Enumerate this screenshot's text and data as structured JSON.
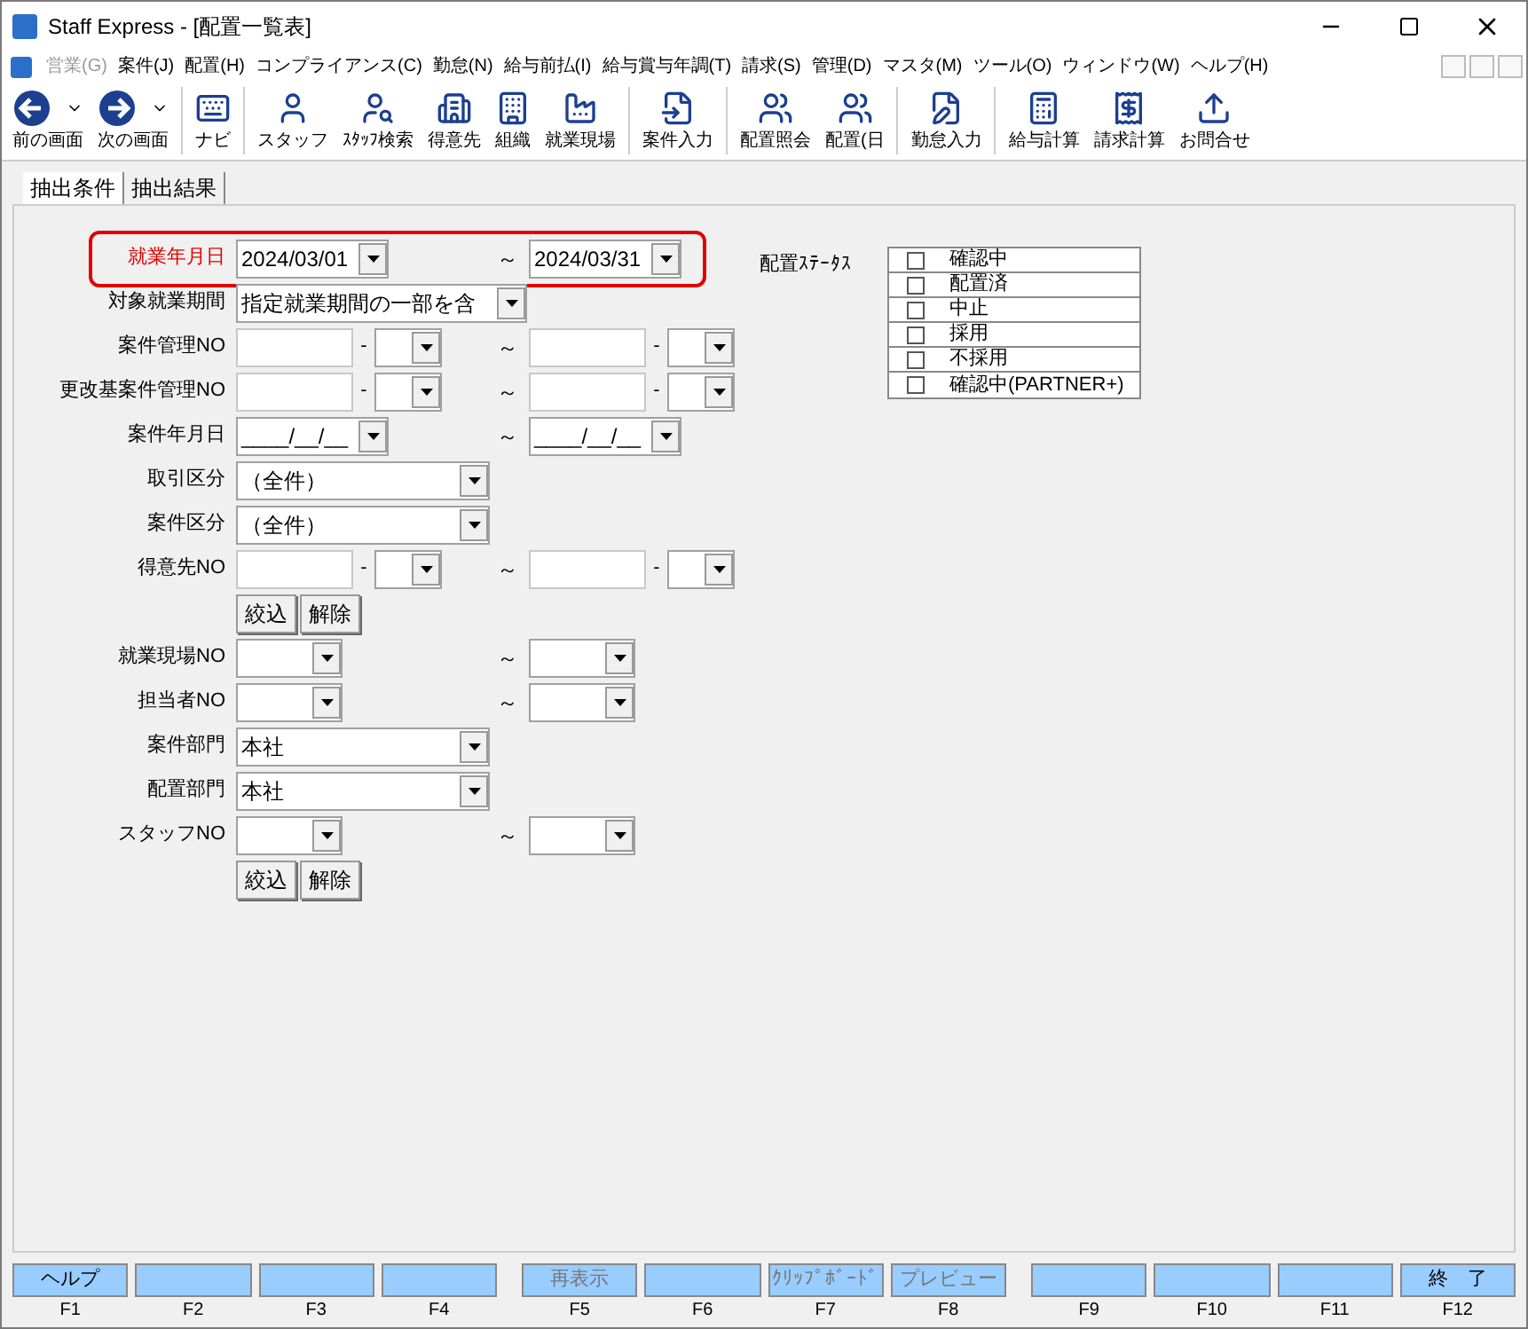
{
  "window": {
    "title": "Staff Express - [配置一覧表]"
  },
  "menu": [
    {
      "label": "営業(G)",
      "disabled": true
    },
    {
      "label": "案件(J)",
      "disabled": false
    },
    {
      "label": "配置(H)",
      "disabled": false
    },
    {
      "label": "コンプライアンス(C)",
      "disabled": false
    },
    {
      "label": "勤怠(N)",
      "disabled": false
    },
    {
      "label": "給与前払(I)",
      "disabled": false
    },
    {
      "label": "給与賞与年調(T)",
      "disabled": false
    },
    {
      "label": "請求(S)",
      "disabled": false
    },
    {
      "label": "管理(D)",
      "disabled": false
    },
    {
      "label": "マスタ(M)",
      "disabled": false
    },
    {
      "label": "ツール(O)",
      "disabled": false
    },
    {
      "label": "ウィンドウ(W)",
      "disabled": false
    },
    {
      "label": "ヘルプ(H)",
      "disabled": false
    }
  ],
  "toolbar": [
    [
      {
        "label": "前の画面",
        "dropdown": true
      },
      {
        "label": "次の画面",
        "dropdown": true
      }
    ],
    [
      {
        "label": "ナビ",
        "dropdown": false
      }
    ],
    [
      {
        "label": "スタッフ",
        "dropdown": false
      },
      {
        "label": "ｽﾀｯﾌ検索",
        "dropdown": false
      },
      {
        "label": "得意先",
        "dropdown": false
      },
      {
        "label": "組織",
        "dropdown": false
      },
      {
        "label": "就業現場",
        "dropdown": false
      }
    ],
    [
      {
        "label": "案件入力",
        "dropdown": false
      }
    ],
    [
      {
        "label": "配置照会",
        "dropdown": false
      },
      {
        "label": "配置(日",
        "dropdown": false
      }
    ],
    [
      {
        "label": "勤怠入力",
        "dropdown": false
      }
    ],
    [
      {
        "label": "給与計算",
        "dropdown": false
      },
      {
        "label": "請求計算",
        "dropdown": false
      },
      {
        "label": "お問合せ",
        "dropdown": false
      }
    ]
  ],
  "tabs": [
    {
      "label": "抽出条件",
      "selected": true
    },
    {
      "label": "抽出結果",
      "selected": false
    }
  ],
  "form": {
    "rows": [
      {
        "kind": "date_range",
        "label": "就業年月日",
        "highlighted": true,
        "from": "2024/03/01",
        "tilde": "～",
        "to": "2024/03/31"
      },
      {
        "kind": "period",
        "label": "対象就業期間",
        "value": "指定就業期間の一部を含"
      },
      {
        "kind": "no_range",
        "label": "案件管理NO",
        "dash": "-",
        "tilde": "～",
        "dash2": "-"
      },
      {
        "kind": "no_range",
        "label": "更改基案件管理NO",
        "dash": "-",
        "tilde": "～",
        "dash2": "-"
      },
      {
        "kind": "date_range",
        "label": "案件年月日",
        "from": "____/__/__",
        "tilde": "～",
        "to": "____/__/__"
      },
      {
        "kind": "select",
        "label": "取引区分",
        "value": "（全件）"
      },
      {
        "kind": "select",
        "label": "案件区分",
        "value": "（全件）"
      },
      {
        "kind": "no_range",
        "label": "得意先NO",
        "dash": "-",
        "tilde": "～",
        "dash2": "-"
      },
      {
        "kind": "buttons",
        "buttons": [
          "絞込",
          "解除"
        ]
      },
      {
        "kind": "combo_range",
        "label": "就業現場NO",
        "tilde": "～"
      },
      {
        "kind": "combo_range",
        "label": "担当者NO",
        "tilde": "～"
      },
      {
        "kind": "select",
        "label": "案件部門",
        "value": "本社"
      },
      {
        "kind": "select",
        "label": "配置部門",
        "value": "本社"
      },
      {
        "kind": "combo_range",
        "label": "スタッフNO",
        "tilde": "～"
      },
      {
        "kind": "buttons",
        "buttons": [
          "絞込",
          "解除"
        ]
      }
    ]
  },
  "status": {
    "label": "配置ｽﾃｰﾀｽ",
    "items": [
      {
        "label": "確認中",
        "checked": false
      },
      {
        "label": "配置済",
        "checked": false
      },
      {
        "label": "中止",
        "checked": false
      },
      {
        "label": "採用",
        "checked": false
      },
      {
        "label": "不採用",
        "checked": false
      },
      {
        "label": "確認中(PARTNER+)",
        "checked": false
      }
    ]
  },
  "function_keys": [
    {
      "label": "ヘルプ",
      "key": "F1",
      "disabled": false
    },
    {
      "key": "F2"
    },
    {
      "key": "F3"
    },
    {
      "key": "F4"
    },
    {
      "label": "再表示",
      "key": "F5",
      "disabled": true
    },
    {
      "key": "F6"
    },
    {
      "label": "ｸﾘｯﾌﾟﾎﾞｰﾄﾞ",
      "key": "F7",
      "disabled": true
    },
    {
      "label": "プレビュー",
      "key": "F8",
      "disabled": true
    },
    {
      "key": "F9"
    },
    {
      "key": "F10"
    },
    {
      "key": "F11"
    },
    {
      "label": "終　了",
      "key": "F12",
      "disabled": false
    }
  ]
}
